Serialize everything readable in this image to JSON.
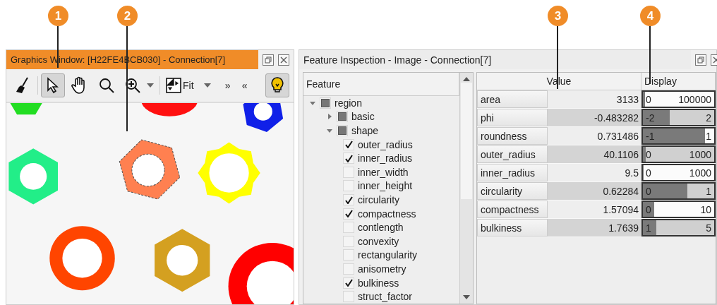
{
  "callouts": [
    {
      "number": "1"
    },
    {
      "number": "2"
    },
    {
      "number": "3"
    },
    {
      "number": "4"
    }
  ],
  "graphics_window": {
    "title": "Graphics Window: [H22FE4BCB030] - Connection[7]",
    "toolbar": [
      {
        "kind": "broom",
        "selected": false
      },
      {
        "kind": "pointer",
        "selected": true
      },
      {
        "kind": "hand",
        "selected": false
      },
      {
        "kind": "magnifier",
        "selected": false
      },
      {
        "kind": "zoom",
        "selected": false
      },
      {
        "kind": "fit",
        "label": "Fit",
        "selected": false
      },
      {
        "kind": "more",
        "label": "»"
      },
      {
        "kind": "less",
        "label": "«"
      },
      {
        "kind": "bulb",
        "selected": true
      }
    ]
  },
  "feature_window": {
    "title": "Feature Inspection - Image - Connection[7]",
    "tree_header": "Feature",
    "tree": [
      {
        "label": "region",
        "partial": true,
        "expanded": true,
        "children": [
          {
            "label": "basic",
            "partial": true,
            "expanded": false
          },
          {
            "label": "shape",
            "partial": true,
            "expanded": true,
            "children": [
              {
                "label": "outer_radius",
                "checked": true
              },
              {
                "label": "inner_radius",
                "checked": true
              },
              {
                "label": "inner_width",
                "checked": false
              },
              {
                "label": "inner_height",
                "checked": false
              },
              {
                "label": "circularity",
                "checked": true
              },
              {
                "label": "compactness",
                "checked": true
              },
              {
                "label": "contlength",
                "checked": false
              },
              {
                "label": "convexity",
                "checked": false
              },
              {
                "label": "rectangularity",
                "checked": false
              },
              {
                "label": "anisometry",
                "checked": false
              },
              {
                "label": "bulkiness",
                "checked": true
              },
              {
                "label": "struct_factor",
                "checked": false
              }
            ]
          }
        ]
      }
    ],
    "columns": [
      "Value",
      "Display"
    ],
    "rows": [
      {
        "name": "area",
        "value": "3133",
        "min": "0",
        "max": "100000",
        "level": 0.03
      },
      {
        "name": "phi",
        "value": "-0.483282",
        "min": "-2",
        "max": "2",
        "level": 0.38
      },
      {
        "name": "roundness",
        "value": "0.731486",
        "min": "-1",
        "max": "1",
        "level": 0.87
      },
      {
        "name": "outer_radius",
        "value": "40.1106",
        "min": "0",
        "max": "1000",
        "level": 0.04
      },
      {
        "name": "inner_radius",
        "value": "9.5",
        "min": "0",
        "max": "1000",
        "level": 0.01
      },
      {
        "name": "circularity",
        "value": "0.62284",
        "min": "0",
        "max": "1",
        "level": 0.62
      },
      {
        "name": "compactness",
        "value": "1.57094",
        "min": "0",
        "max": "10",
        "level": 0.16
      },
      {
        "name": "bulkiness",
        "value": "1.7639",
        "min": "1",
        "max": "5",
        "level": 0.19
      }
    ]
  }
}
